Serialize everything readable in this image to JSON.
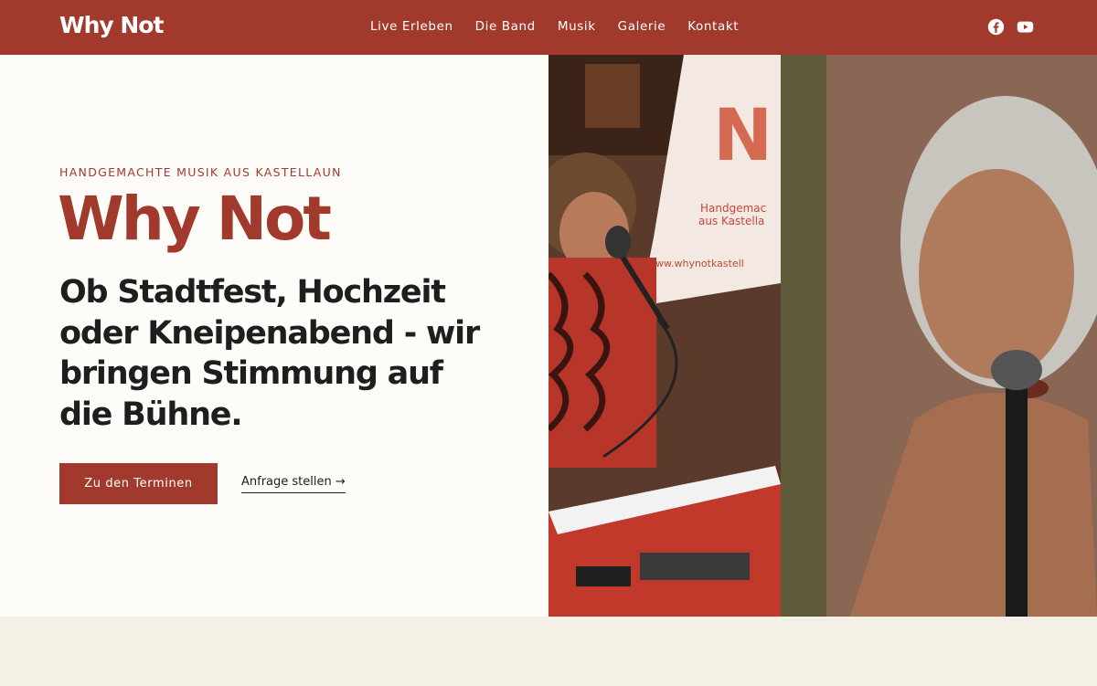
{
  "header": {
    "logo": "Why Not",
    "nav": [
      "Live Erleben",
      "Die Band",
      "Musik",
      "Galerie",
      "Kontakt"
    ],
    "social_icons": [
      "facebook-icon",
      "youtube-icon"
    ]
  },
  "hero": {
    "eyebrow": "HANDGEMACHTE MUSIK AUS KASTELLAUN",
    "title": "Why Not",
    "headline": "Ob Stadtfest, Hochzeit oder Kneipenabend - wir bringen Stimmung auf die Bühne.",
    "primary_button": "Zu den Terminen",
    "secondary_link": "Anfrage stellen",
    "banner_letters": "N",
    "banner_text_1": "Handgemac",
    "banner_text_2": "aus Kastella",
    "banner_url": "www.whynotkastell"
  },
  "colors": {
    "brand": "#a13a2c",
    "hero_background": "#fdfcf8",
    "page_background": "#f5f0e6",
    "text_dark": "#1e1e1e"
  }
}
